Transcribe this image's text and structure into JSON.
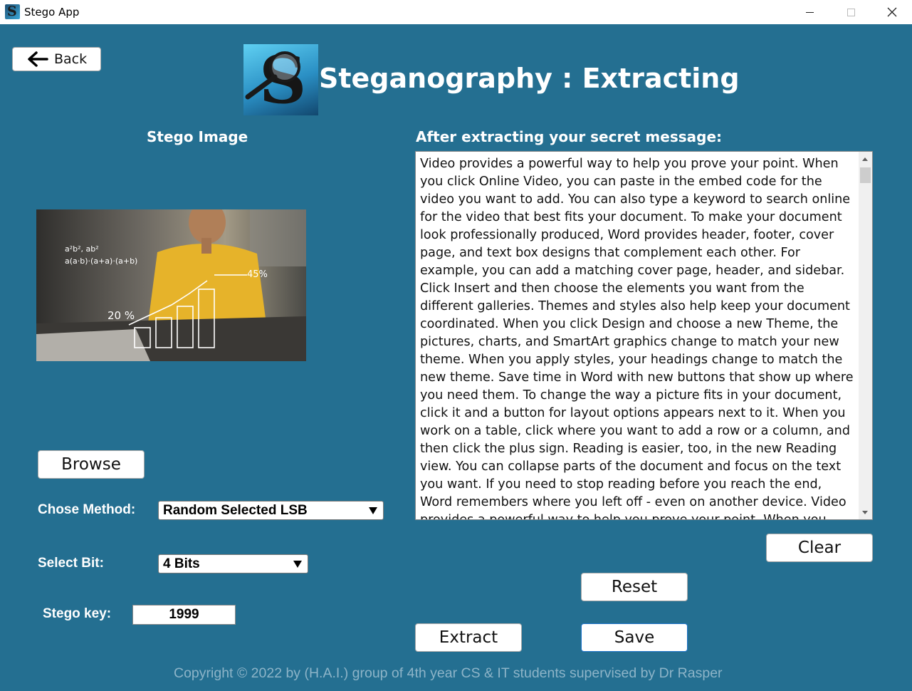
{
  "window": {
    "title": "Stego App",
    "icon": "stego-app-icon",
    "close_glyph": "✕"
  },
  "header": {
    "back_label": "Back",
    "title": "Steganography : Extracting"
  },
  "left": {
    "image_heading": "Stego Image",
    "image_overlay_texts": [
      "a²b², ab²",
      "a(a·b)·(a+a)·(a+b)",
      "45%",
      "20 %"
    ],
    "browse_label": "Browse",
    "method_label": "Chose Method:",
    "method_value": "Random Selected LSB",
    "bit_label": "Select Bit:",
    "bit_value": "4 Bits",
    "key_label": "Stego key:",
    "key_value": "1999"
  },
  "right": {
    "heading": "After extracting your secret message:",
    "message": "Video provides a powerful way to help you prove your point. When you click Online Video, you can paste in the embed code for the video you want to add. You can also type a keyword to search online for the video that best fits your document. To make your document look professionally produced, Word provides header, footer, cover page, and text box designs that complement each other. For example, you can add a matching cover page, header, and sidebar. Click Insert and then choose the elements you want from the different galleries. Themes and styles also help keep your document coordinated. When you click Design and choose a new Theme, the pictures, charts, and SmartArt graphics change to match your new theme. When you apply styles, your headings change to match the new theme. Save time in Word with new buttons that show up where you need them. To change the way a picture fits in your document, click it and a button for layout options appears next to it. When you work on a table, click where you want to add a row or a column, and then click the plus sign. Reading is easier, too, in the new Reading view. You can collapse parts of the document and focus on the text you want. If you need to stop reading before you reach the end, Word remembers where you left off - even on another device. Video provides a powerful way to help you prove your point. When you click Online Video, you can paste in the embed code for the video you want to add.",
    "clear_label": "Clear",
    "reset_label": "Reset",
    "extract_label": "Extract",
    "save_label": "Save"
  },
  "footer": {
    "copyright": "Copyright © 2022 by (H.A.I.) group of 4th year CS & IT students supervised by Dr Rasper"
  },
  "colors": {
    "background": "#246f91",
    "text_on_bg": "#ffffff",
    "footer_text": "#8db4c8"
  }
}
